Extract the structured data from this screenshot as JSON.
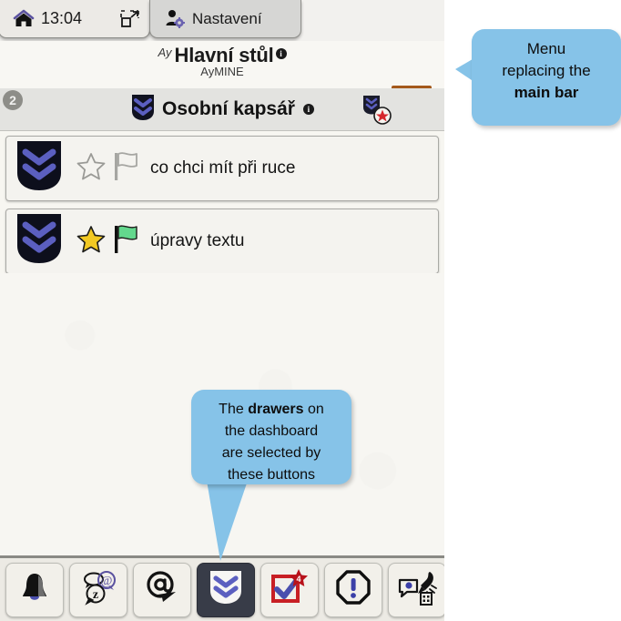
{
  "window": {
    "tabs": [
      {
        "id": "home",
        "label": "13:04",
        "icon": "home-icon",
        "secondary_icon": "expand-icon",
        "active": false
      },
      {
        "id": "settings",
        "label": "Nastavení",
        "icon": "user-settings-icon",
        "active": true
      }
    ]
  },
  "app": {
    "title": "Hlavní stůl",
    "title_mark": "Ay",
    "title_info": "i",
    "subtitle": "AyMINE",
    "menu_icon": "hamburger-menu-icon",
    "menu_color": "#a4591b"
  },
  "section": {
    "badge": "2",
    "title": "Osobní kapsář",
    "info": "i",
    "icon": "pocket-chevrons-icon",
    "action_icon": "pocket-new-star-icon"
  },
  "list": {
    "items": [
      {
        "icon": "pocket-chevrons-icon",
        "star": "star-outline-icon",
        "star_state": "off",
        "flag": "flag-outline-icon",
        "flag_state": "off",
        "label": "co chci mít při ruce"
      },
      {
        "icon": "pocket-chevrons-icon",
        "star": "star-filled-icon",
        "star_state": "on",
        "flag": "flag-filled-icon",
        "flag_state": "green",
        "label": "úpravy textu"
      }
    ]
  },
  "toolbar": {
    "buttons": [
      {
        "id": "notifications",
        "icon": "bell-icon",
        "selected": false,
        "badge": null
      },
      {
        "id": "messages",
        "icon": "chat-bubbles-az-icon",
        "selected": false,
        "badge": null
      },
      {
        "id": "mail",
        "icon": "at-send-icon",
        "selected": false,
        "badge": null
      },
      {
        "id": "pocket",
        "icon": "pocket-chevrons-icon",
        "selected": true,
        "badge": null
      },
      {
        "id": "tasks",
        "icon": "checkbox-check-icon",
        "selected": false,
        "badge": "4"
      },
      {
        "id": "issues",
        "icon": "octagon-exclamation-icon",
        "selected": false,
        "badge": null
      },
      {
        "id": "projects",
        "icon": "rocket-tag-building-icon",
        "selected": false,
        "badge": null
      }
    ]
  },
  "callouts": {
    "menu": {
      "line1": "Menu",
      "line2": "replacing the",
      "line3": "main bar",
      "color": "#86c3e8"
    },
    "drawers": {
      "line1a": "The ",
      "line1b": "drawers",
      "line1c": " on",
      "line2": "the dashboard",
      "line3": "are selected by",
      "line4": "these buttons",
      "color": "#86c3e8"
    }
  }
}
